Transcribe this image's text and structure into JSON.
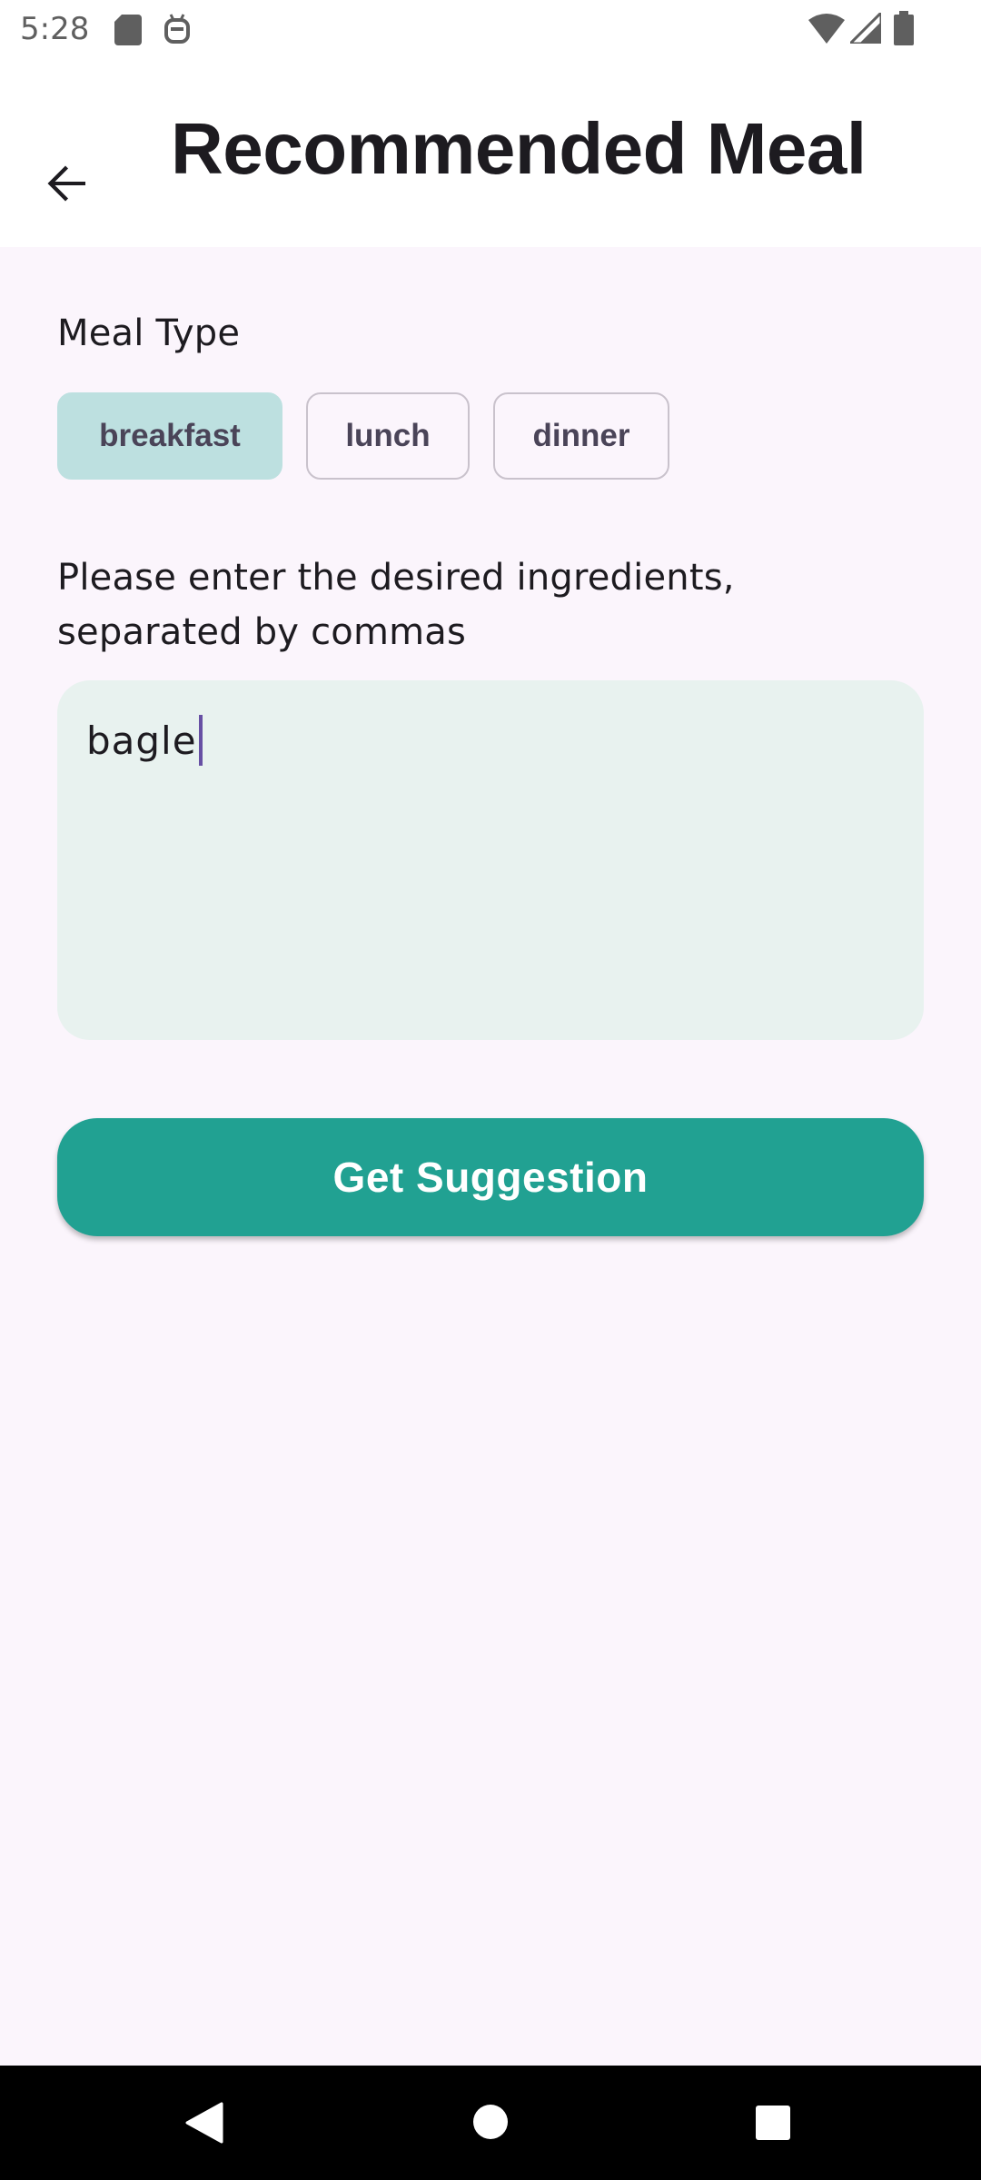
{
  "status_bar": {
    "time": "5:28",
    "left_icons": [
      "sd-card-icon",
      "robot-icon"
    ],
    "right_icons": [
      "wifi-icon",
      "signal-icon",
      "battery-icon"
    ]
  },
  "app_bar": {
    "back_icon": "arrow-back-icon",
    "title": "Recommended Meal"
  },
  "meal_type": {
    "label": "Meal Type",
    "options": [
      {
        "label": "breakfast",
        "selected": true
      },
      {
        "label": "lunch",
        "selected": false
      },
      {
        "label": "dinner",
        "selected": false
      }
    ]
  },
  "ingredients": {
    "label": "Please enter the desired ingredients, separated by commas",
    "value": "bagle"
  },
  "actions": {
    "submit_label": "Get Suggestion"
  },
  "nav_bar": {
    "icons": [
      "back-triangle-icon",
      "home-circle-icon",
      "recents-square-icon"
    ]
  },
  "colors": {
    "background": "#fbf5fc",
    "selected_chip": "#bde0e0",
    "field_fill": "#e8f2ef",
    "primary": "#21a192",
    "cursor": "#6750a4"
  }
}
